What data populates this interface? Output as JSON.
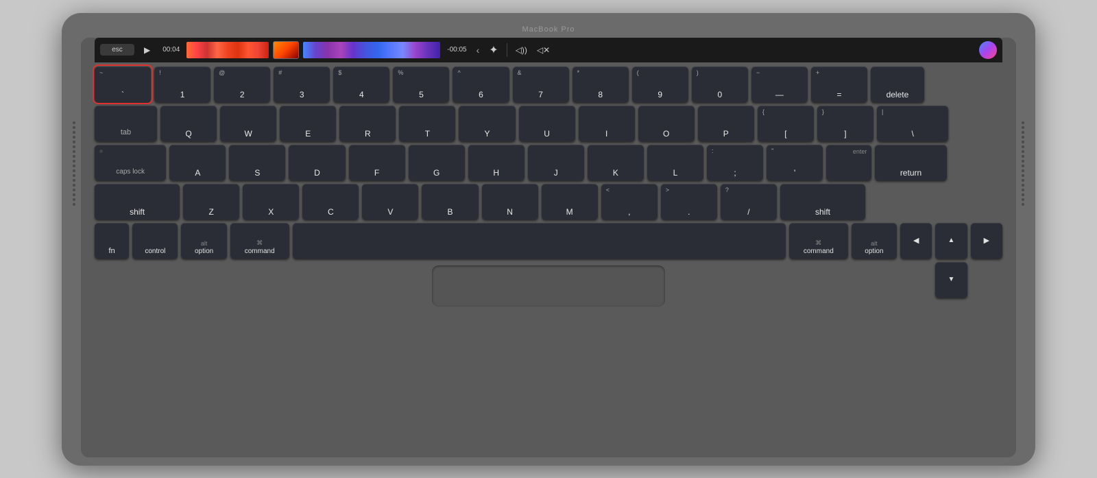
{
  "macbook": {
    "model": "MacBook Pro",
    "brand_color": "#6b6b6b"
  },
  "touch_bar": {
    "esc": "esc",
    "play_icon": "▶",
    "time_start": "00:04",
    "time_end": "-00:05",
    "chevron": "‹",
    "brightness_icon": "☀",
    "volume_icon": "◁))",
    "mute_icon": "◁×"
  },
  "row1": {
    "tilde": "~",
    "backtick": "`",
    "exclaim": "!",
    "k1": "1",
    "at": "@",
    "k2": "2",
    "hash": "#",
    "k3": "3",
    "dollar": "$",
    "k4": "4",
    "percent": "%",
    "k5": "5",
    "caret": "^",
    "k6": "6",
    "amp": "&",
    "k7": "7",
    "star": "*",
    "k8": "8",
    "lparen": "(",
    "k9": "9",
    "rparen": ")",
    "k0": "0",
    "minus": "−",
    "dash": "—",
    "plus": "+",
    "equals": "=",
    "delete": "delete"
  },
  "row2": {
    "tab": "tab",
    "q": "Q",
    "w": "W",
    "e": "E",
    "r": "R",
    "t": "T",
    "y": "Y",
    "u": "U",
    "i": "I",
    "o": "O",
    "p": "P",
    "lbrace": "{",
    "lbracket": "[",
    "rbrace": "}",
    "rbracket": "]",
    "pipe": "|",
    "backslash": "\\"
  },
  "row3": {
    "caps_lock": "caps lock",
    "a": "A",
    "s": "S",
    "d": "D",
    "f": "F",
    "g": "G",
    "h": "H",
    "j": "J",
    "k": "K",
    "l": "L",
    "colon": ":",
    "semicolon": ";",
    "quote": "\"",
    "apostrophe": "'",
    "enter": "enter",
    "return": "return"
  },
  "row4": {
    "shift_left": "shift",
    "z": "Z",
    "x": "X",
    "c": "C",
    "v": "V",
    "b": "B",
    "n": "N",
    "m": "M",
    "lt": "<",
    "comma": ",",
    "gt": ">",
    "period": ".",
    "question": "?",
    "slash": "/",
    "shift_right": "shift"
  },
  "row5": {
    "fn": "fn",
    "control": "control",
    "alt_left": "alt",
    "option_left": "option",
    "command_symbol_left": "⌘",
    "command_left": "command",
    "space": "",
    "command_symbol_right": "⌘",
    "command_right": "command",
    "alt_right": "alt",
    "option_right": "option",
    "arrow_left": "◀",
    "arrow_up": "▲",
    "arrow_down": "▼",
    "arrow_right": "▶"
  }
}
